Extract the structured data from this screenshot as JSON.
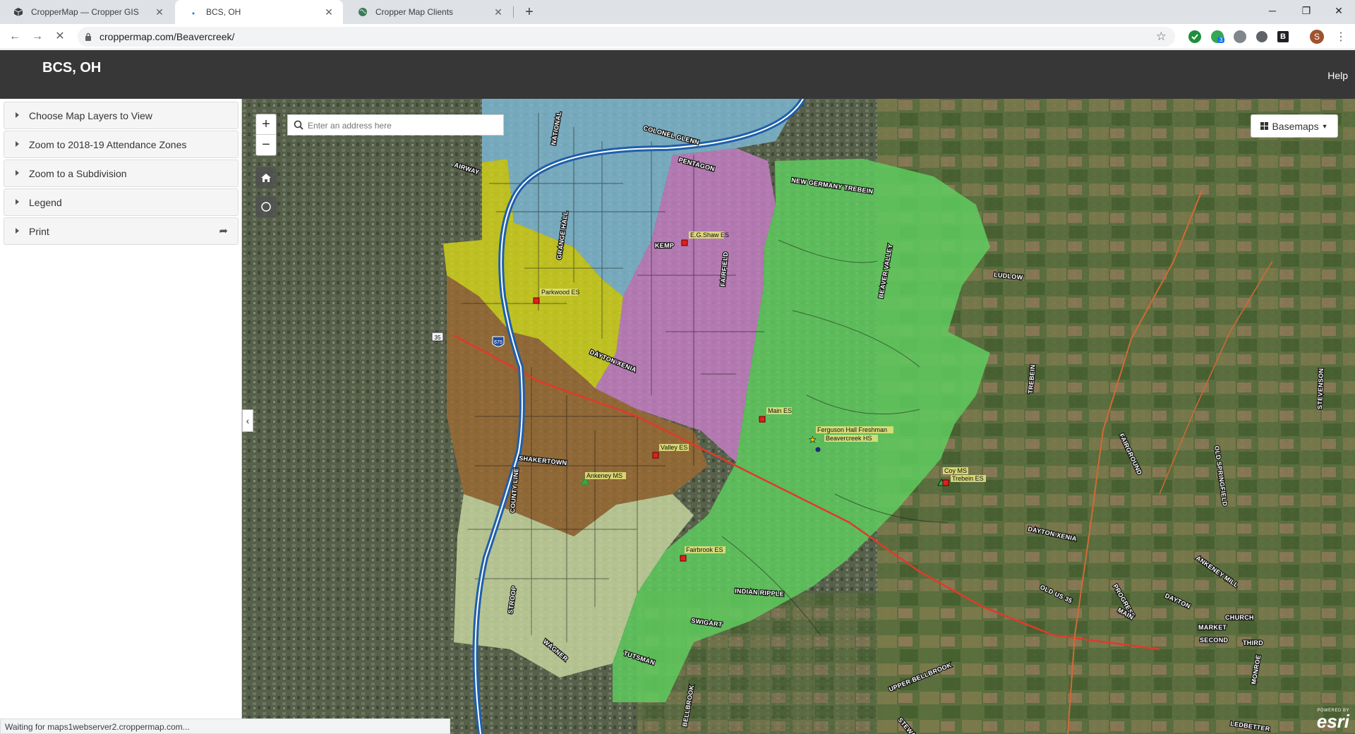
{
  "browser": {
    "tabs": [
      {
        "title": "CropperMap — Cropper GIS",
        "favicon": "cube-icon"
      },
      {
        "title": "BCS, OH",
        "favicon": "loading-dot"
      },
      {
        "title": "Cropper Map Clients",
        "favicon": "globe-icon"
      }
    ],
    "url": "croppermap.com/Beavercreek/",
    "profile_initial": "S",
    "extension_badge": "3",
    "status": "Waiting for maps1webserver2.croppermap.com..."
  },
  "app": {
    "title": "BCS, OH",
    "help": "Help"
  },
  "sidebar": {
    "panels": [
      {
        "label": "Choose Map Layers to View"
      },
      {
        "label": "Zoom to 2018-19 Attendance Zones"
      },
      {
        "label": "Zoom to a Subdivision"
      },
      {
        "label": "Legend"
      },
      {
        "label": "Print"
      }
    ]
  },
  "map": {
    "search_placeholder": "Enter an address here",
    "basemaps_label": "Basemaps",
    "attribution_top": "POWERED BY",
    "attribution_logo": "esri",
    "zone_colors": {
      "blue": "#7fb9d6",
      "yellow": "#d4d41a",
      "purple": "#c77fc7",
      "brown": "#9c6a34",
      "light_green": "#c8d8a0",
      "green": "#5fd05f"
    },
    "schools": [
      "E.G.Shaw ES",
      "Parkwood ES",
      "Main ES",
      "Ferguson Hall Freshman",
      "Beavercreek HS",
      "Valley ES",
      "Ankeney MS",
      "Coy MS",
      "Trebein ES",
      "Fairbrook ES"
    ],
    "roads": [
      "COLONEL GLENN",
      "PENTAGON",
      "NEW GERMANY TREBEIN",
      "AIRWAY",
      "NATIONAL",
      "GRANGE HALL",
      "KEMP",
      "FAIRFIELD",
      "BEAVER VALLEY",
      "LUDLOW",
      "DAYTON XENIA",
      "TREBEIN",
      "SHAKERTOWN",
      "COUNTY LINE",
      "INDIAN RIPPLE",
      "SWIGART",
      "STROOP",
      "WAGNER",
      "TUTSMAN",
      "UPPER BELLBROOK",
      "BELLBROOK",
      "STEWART",
      "FAIRGROUND",
      "OLD SPRINGFIELD",
      "STEVENSON",
      "ANKENEY MILL",
      "OLD US 35",
      "PROGRESS",
      "DAYTON",
      "MAIN",
      "MARKET",
      "CHURCH",
      "SECOND",
      "THIRD",
      "MONROE",
      "LEDBETTER",
      "35",
      "675"
    ]
  }
}
